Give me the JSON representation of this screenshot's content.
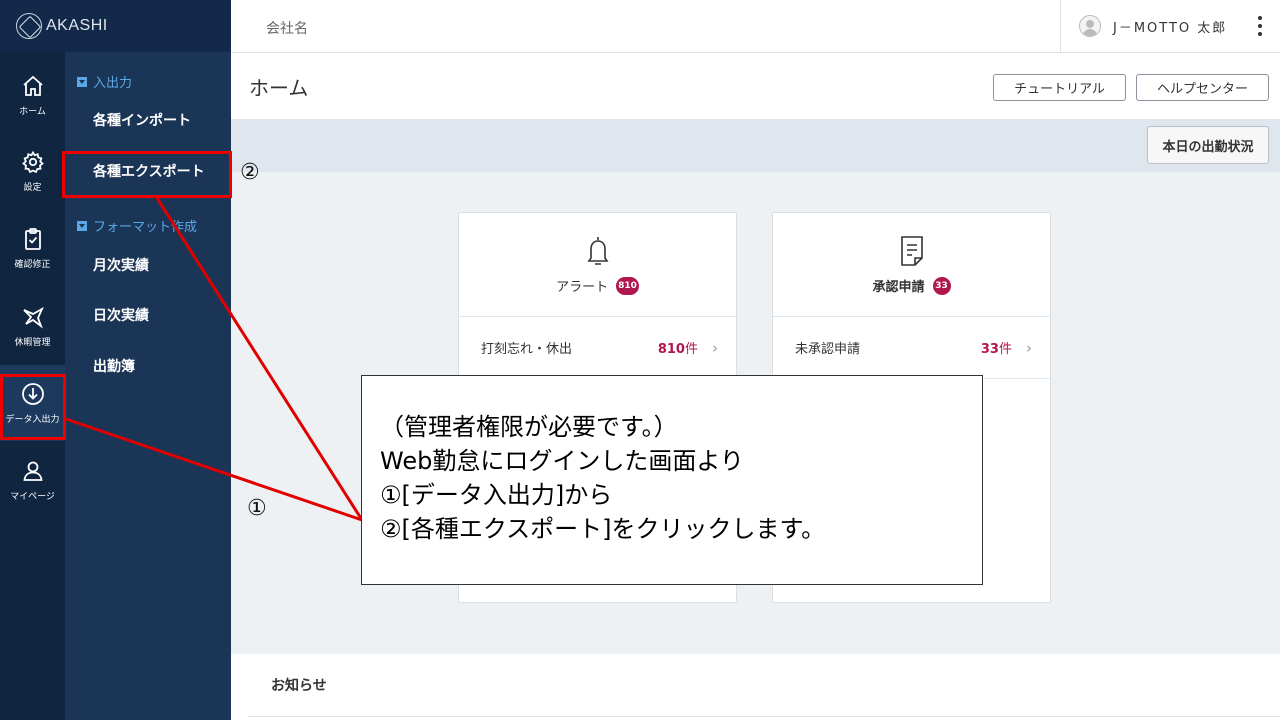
{
  "app": {
    "logo_text": "AKASHI"
  },
  "rail": {
    "items": [
      {
        "label": "ホーム",
        "icon": "home-icon"
      },
      {
        "label": "設定",
        "icon": "gear-icon"
      },
      {
        "label": "確認修正",
        "icon": "clipboard-check-icon"
      },
      {
        "label": "休暇管理",
        "icon": "plane-icon"
      },
      {
        "label": "データ入出力",
        "icon": "download-icon"
      },
      {
        "label": "マイページ",
        "icon": "user-icon"
      }
    ]
  },
  "submenu": {
    "section1": "入出力",
    "import": "各種インポート",
    "export": "各種エクスポート",
    "section2": "フォーマット作成",
    "monthly": "月次実績",
    "daily": "日次実績",
    "attendance": "出勤簿"
  },
  "header": {
    "company": "会社名",
    "user": "J－MOTTO 太郎"
  },
  "title": "ホーム",
  "buttons": {
    "tutorial": "チュートリアル",
    "help": "ヘルプセンター",
    "today_status": "本日の出勤状況"
  },
  "cards": {
    "alert": {
      "title": "アラート",
      "badge": "810",
      "row_label": "打刻忘れ・休出",
      "row_count": "810",
      "row_unit": "件"
    },
    "approval": {
      "title": "承認申請",
      "badge": "33",
      "row_label": "未承認申請",
      "row_count": "33",
      "row_unit": "件"
    }
  },
  "news": {
    "title": "お知らせ"
  },
  "annotation": {
    "marker1": "①",
    "marker2": "②",
    "lines": [
      "（管理者権限が必要です。）",
      "Web勤怠にログインした画面より",
      "①[データ入出力]から",
      "②[各種エクスポート]をクリックします。"
    ]
  },
  "colors": {
    "rail": "#0f2540",
    "submenu": "#1b3556",
    "accent": "#5aa9e6",
    "badge": "#b0174f",
    "highlight": "#e00000"
  }
}
